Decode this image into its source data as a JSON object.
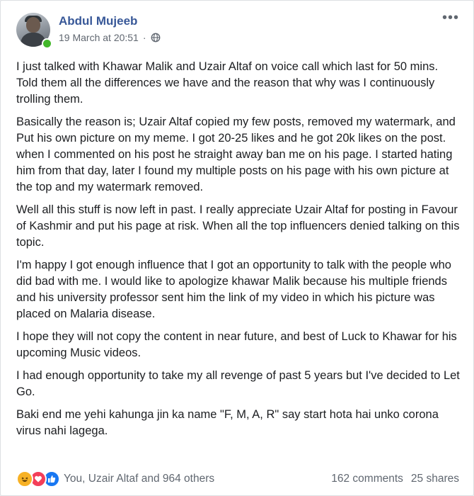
{
  "post": {
    "author": "Abdul Mujeeb",
    "timestamp": "19 March at 20:51",
    "separator": "·",
    "privacy_icon": "globe-icon",
    "paragraphs": [
      "I just talked with Khawar Malik and Uzair Altaf on voice call which last for 50 mins. Told them all the differences we have and the reason that why was I continuously trolling them.",
      "Basically the reason is; Uzair Altaf copied my few posts, removed my watermark, and Put his own picture on my meme. I got 20-25 likes and he got 20k likes on the post. when I commented on his post he straight away ban me on his page. I started hating him from that day, later I found my multiple posts on his page with his own picture at the top and my watermark removed.",
      "Well all this stuff is now left in past. I really appreciate Uzair Altaf for posting in Favour of Kashmir and put his page at risk. When all the top influencers denied talking on this topic.",
      "I'm happy I got enough influence that I got an opportunity to talk with the people who did bad with me. I would like to apologize khawar Malik because his multiple friends and his university professor sent him the link of my video in which his picture was placed on Malaria disease.",
      "I hope they will not copy the content in near future, and best of Luck to Khawar for his upcoming Music videos.",
      "I had enough opportunity to take my all revenge of past 5 years but I've decided to Let Go.",
      "Baki end me yehi kahunga jin ka name \"F, M, A, R\" say start hota hai unko corona virus nahi lagega."
    ]
  },
  "footer": {
    "reactions_text": "You, Uzair Altaf and 964 others",
    "comments": "162 comments",
    "shares": "25 shares"
  },
  "colors": {
    "author_link": "#385898",
    "online": "#42b72a",
    "like": "#1877f2",
    "love": "#f33e58",
    "haha": "#f7b125"
  }
}
